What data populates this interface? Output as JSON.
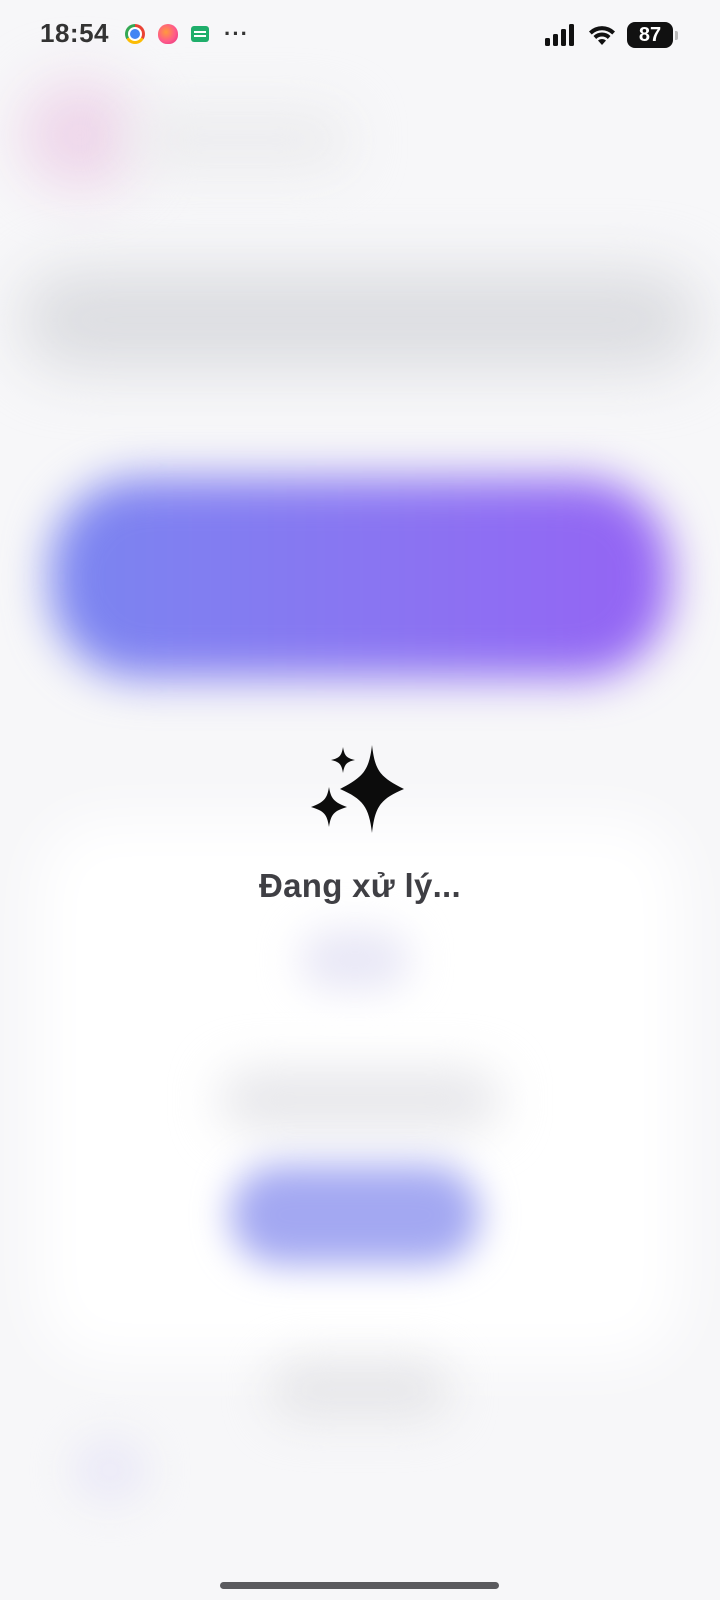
{
  "status_bar": {
    "time": "18:54",
    "app_icons": [
      "chrome-icon",
      "bird-icon",
      "mail-icon"
    ],
    "more_indicator": "···",
    "battery_level": "87",
    "signal_icon": "cellular-signal-icon",
    "wifi_icon": "wifi-icon"
  },
  "processing": {
    "icon": "sparkles-icon",
    "text": "Đang xử lý..."
  },
  "colors": {
    "accent_gradient_start": "#7a86f0",
    "accent_gradient_end": "#9563f4",
    "secondary_button": "#a3a8f2",
    "text": "#3f3f44"
  }
}
